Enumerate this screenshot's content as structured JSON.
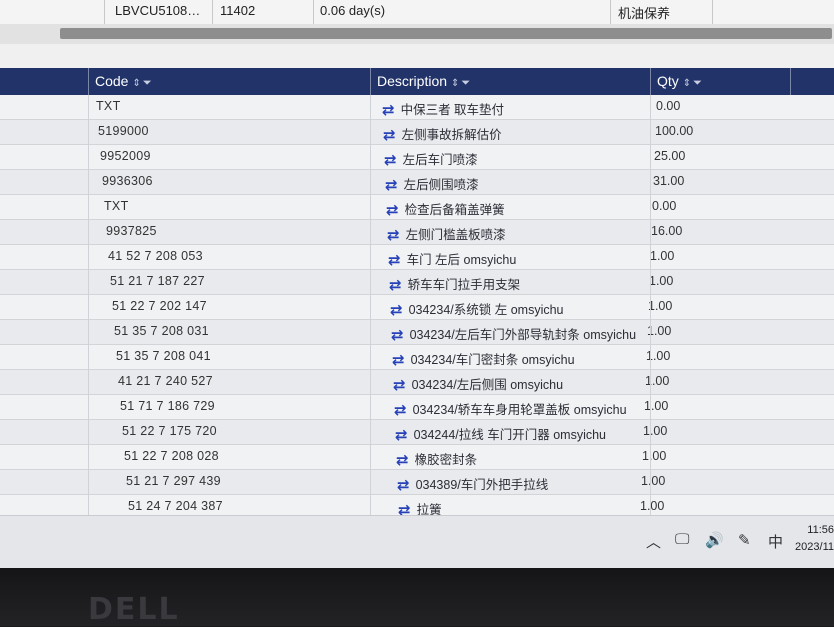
{
  "previous_row": {
    "vin": "LBVCU5108…",
    "number": "11402",
    "duration": "0.06 day(s)",
    "service": "机油保养"
  },
  "table": {
    "columns": [
      {
        "label": "Code"
      },
      {
        "label": "Description"
      },
      {
        "label": "Qty"
      }
    ],
    "sort_icon": "⇕",
    "filter_icon": "⏷",
    "rows": [
      {
        "code": "TXT",
        "description": "中保三者 取车垫付",
        "qty": "0.00"
      },
      {
        "code": "5199000",
        "description": "左侧事故拆解估价",
        "qty": "100.00"
      },
      {
        "code": "9952009",
        "description": "左后车门喷漆",
        "qty": "25.00"
      },
      {
        "code": "9936306",
        "description": "左后侧围喷漆",
        "qty": "31.00"
      },
      {
        "code": "TXT",
        "description": "检查后备箱盖弹簧",
        "qty": "0.00"
      },
      {
        "code": "9937825",
        "description": "左侧门槛盖板喷漆",
        "qty": "16.00"
      },
      {
        "code": "41 52 7 208 053",
        "description": "车门 左后 omsyichu",
        "qty": "1.00"
      },
      {
        "code": "51 21 7 187 227",
        "description": "轿车车门拉手用支架",
        "qty": "1.00"
      },
      {
        "code": "51 22 7 202 147",
        "description": "034234/系统锁 左 omsyichu",
        "qty": "1.00"
      },
      {
        "code": "51 35 7 208 031",
        "description": "034234/左后车门外部导轨封条 omsyichu",
        "qty": "1.00"
      },
      {
        "code": "51 35 7 208 041",
        "description": "034234/车门密封条 omsyichu",
        "qty": "1.00"
      },
      {
        "code": "41 21 7 240 527",
        "description": "034234/左后侧围 omsyichu",
        "qty": "1.00"
      },
      {
        "code": "51 71 7 186 729",
        "description": "034234/轿车车身用轮罩盖板 omsyichu",
        "qty": "1.00"
      },
      {
        "code": "51 22 7 175 720",
        "description": "034244/拉线 车门开门器 omsyichu",
        "qty": "1.00"
      },
      {
        "code": "51 22 7 208 028",
        "description": "橡胶密封条",
        "qty": "1.00"
      },
      {
        "code": "51 21 7 297 439",
        "description": "034389/车门外把手拉线",
        "qty": "1.00"
      },
      {
        "code": "51 24 7 204 387",
        "description": "拉簧",
        "qty": "1.00"
      }
    ]
  },
  "taskbar": {
    "ime": "中",
    "time": "11:56",
    "date": "2023/11"
  },
  "monitor": {
    "brand": "DELL"
  },
  "colors": {
    "header_bg": "#22336a",
    "icon_blue": "#2742b8"
  }
}
